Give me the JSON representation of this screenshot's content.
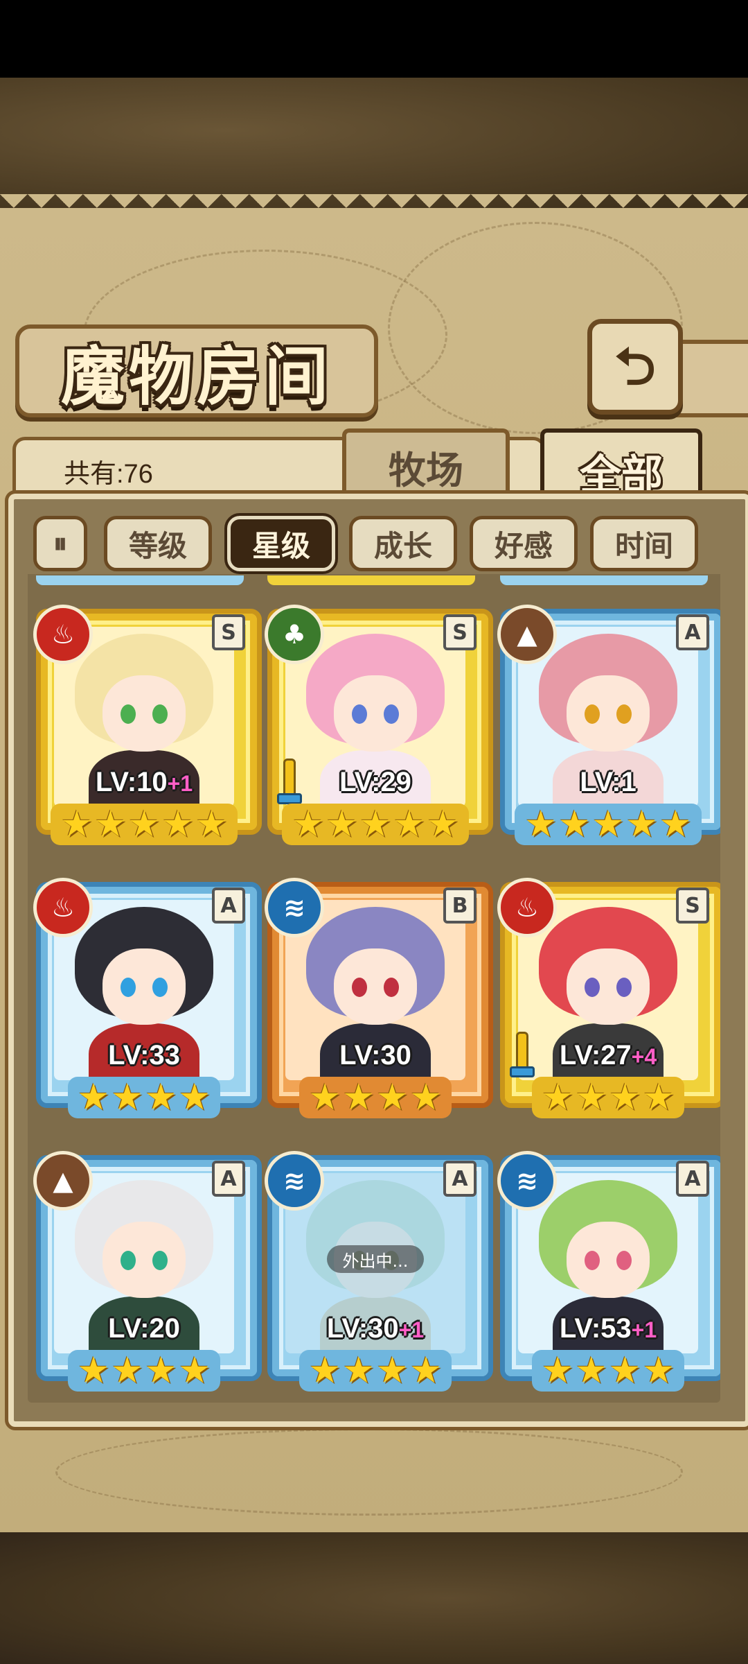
{
  "header": {
    "title": "魔物房间",
    "back_icon": "back-arrow-icon"
  },
  "summary": {
    "count_text": "共有:76"
  },
  "tabs": [
    {
      "label": "牧场",
      "active": false
    },
    {
      "label": "全部",
      "active": true
    }
  ],
  "sort_filters": {
    "toggle_icon": "sort-order-icon",
    "items": [
      {
        "label": "等级",
        "active": false
      },
      {
        "label": "星级",
        "active": true
      },
      {
        "label": "成长",
        "active": false
      },
      {
        "label": "好感",
        "active": false
      },
      {
        "label": "时间",
        "active": false
      }
    ]
  },
  "monsters": [
    {
      "level": "LV:10",
      "bonus": "+1",
      "rank": "S",
      "element": "fire",
      "stars": 5,
      "frame": "gold",
      "weapon": false,
      "status": ""
    },
    {
      "level": "LV:29",
      "bonus": "",
      "rank": "S",
      "element": "wood",
      "stars": 5,
      "frame": "gold",
      "weapon": true,
      "status": ""
    },
    {
      "level": "LV:1",
      "bonus": "",
      "rank": "A",
      "element": "earth",
      "stars": 5,
      "frame": "blue",
      "weapon": false,
      "status": ""
    },
    {
      "level": "LV:33",
      "bonus": "",
      "rank": "A",
      "element": "fire",
      "stars": 4,
      "frame": "blue",
      "weapon": false,
      "status": ""
    },
    {
      "level": "LV:30",
      "bonus": "",
      "rank": "B",
      "element": "water",
      "stars": 4,
      "frame": "orange",
      "weapon": false,
      "status": ""
    },
    {
      "level": "LV:27",
      "bonus": "+4",
      "rank": "S",
      "element": "fire",
      "stars": 4,
      "frame": "gold",
      "weapon": true,
      "status": ""
    },
    {
      "level": "LV:20",
      "bonus": "",
      "rank": "A",
      "element": "earth",
      "stars": 4,
      "frame": "blue",
      "weapon": false,
      "status": ""
    },
    {
      "level": "LV:30",
      "bonus": "+1",
      "rank": "A",
      "element": "water",
      "stars": 4,
      "frame": "blue",
      "weapon": false,
      "status": "外出中..."
    },
    {
      "level": "LV:53",
      "bonus": "+1",
      "rank": "A",
      "element": "water",
      "stars": 4,
      "frame": "blue",
      "weapon": false,
      "status": ""
    }
  ],
  "colors": {
    "parchment": "#c9b483",
    "frame_dark": "#7d5a2b",
    "star": "#ffd21e",
    "bonus": "#ff5fc7"
  }
}
